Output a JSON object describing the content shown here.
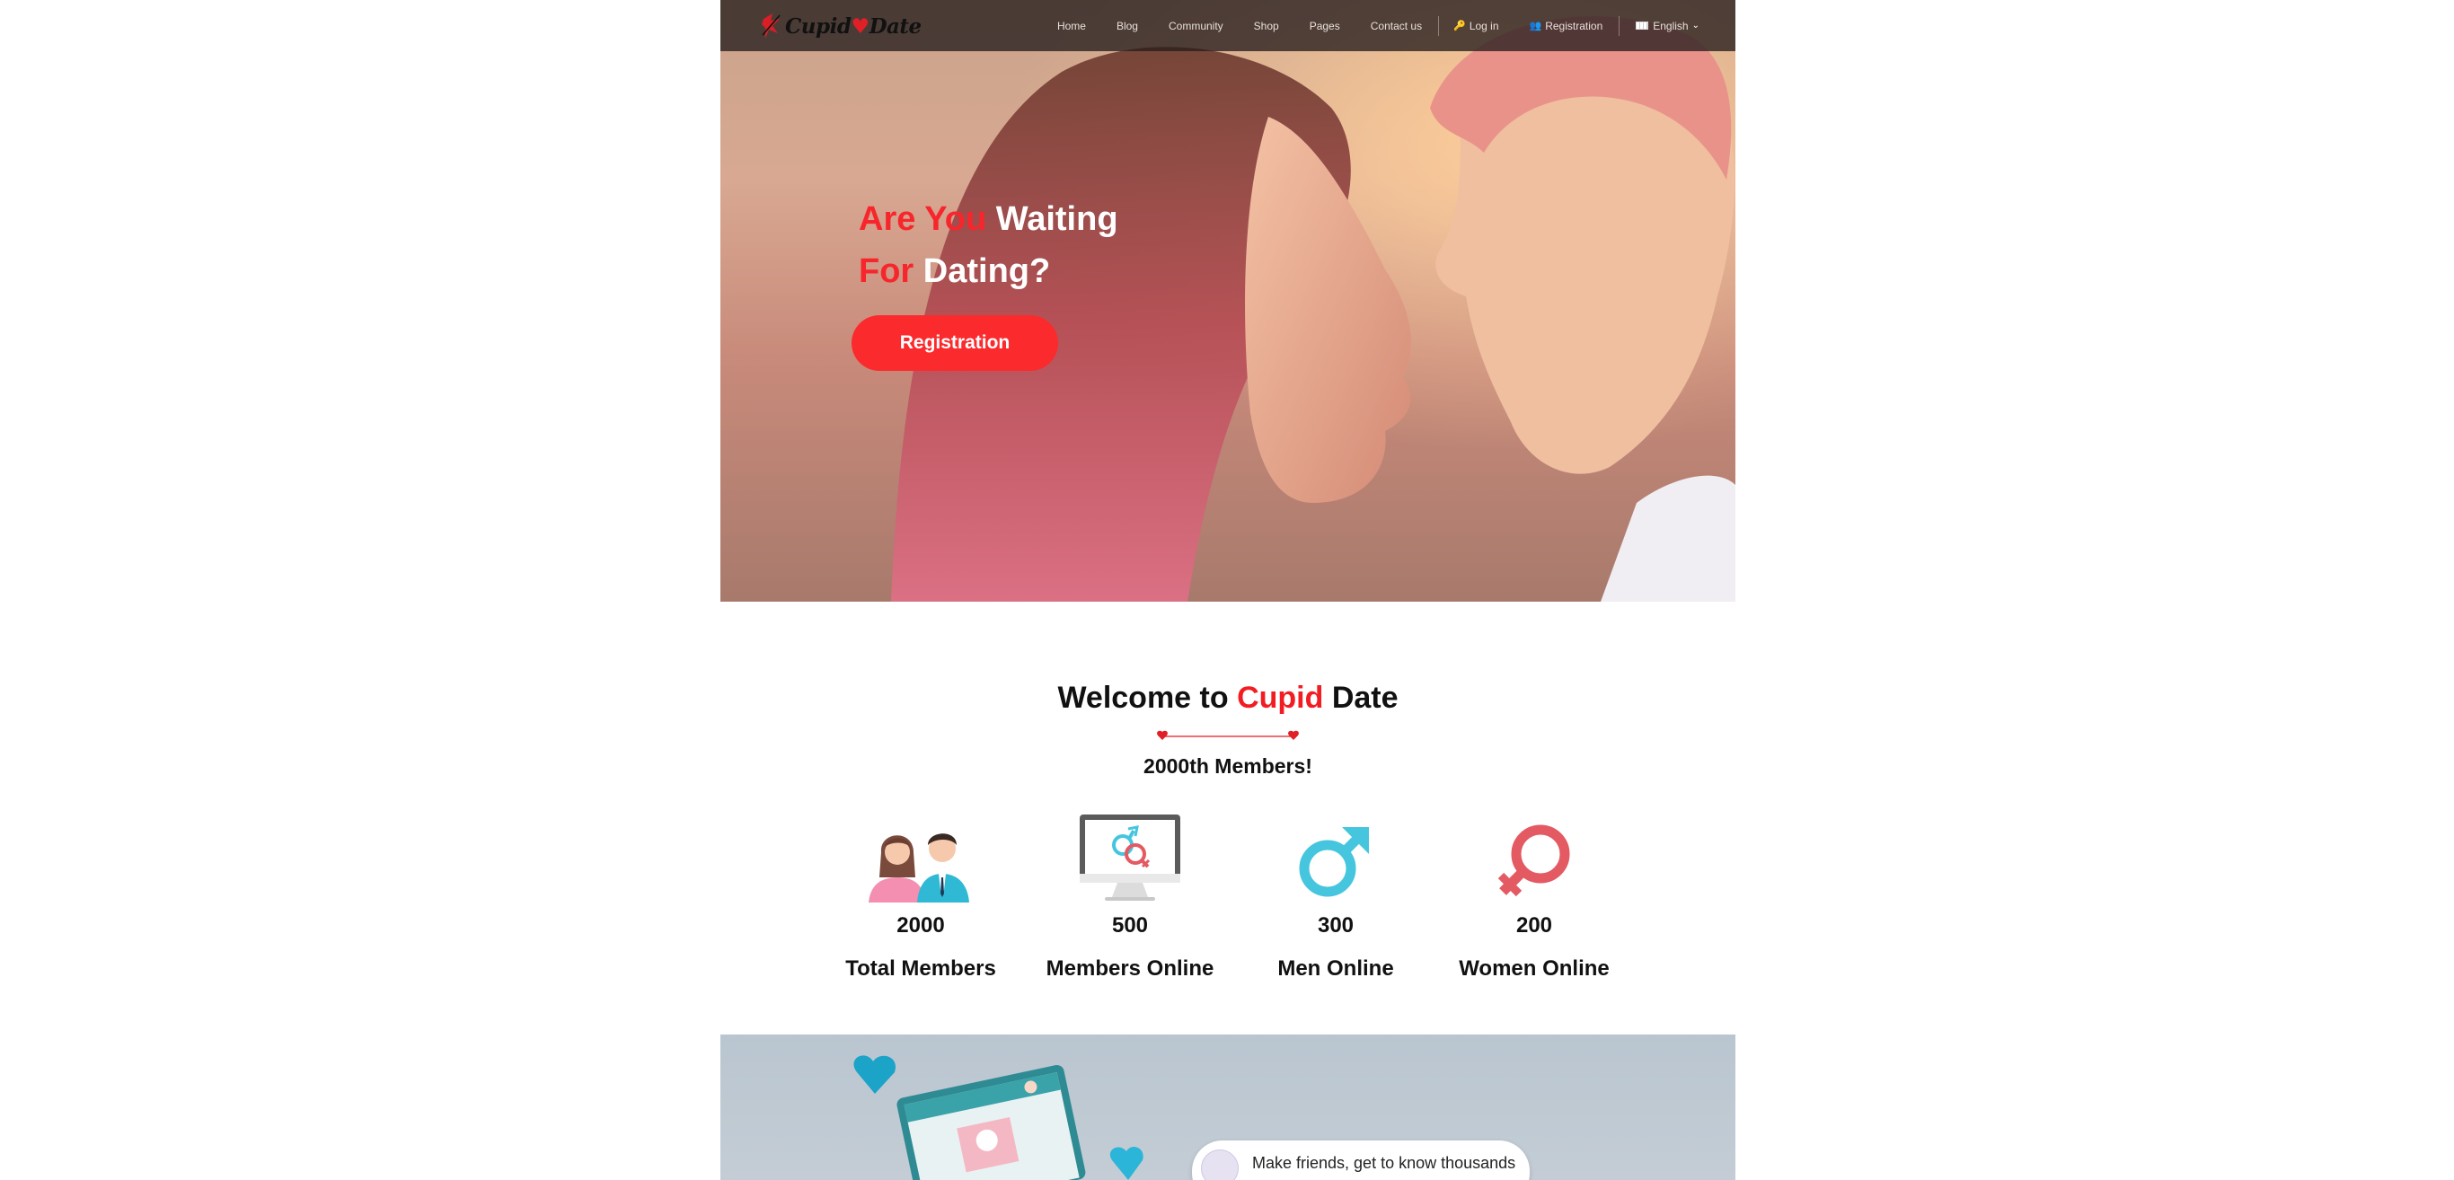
{
  "brand": {
    "name_part1": "Cupid",
    "name_part2": "Date"
  },
  "nav": {
    "links": [
      "Home",
      "Blog",
      "Community",
      "Shop",
      "Pages",
      "Contact us"
    ],
    "login": "Log in",
    "registration": "Registration",
    "language": "English"
  },
  "hero": {
    "line1_red": "Are You",
    "line1_white": "Waiting",
    "line2_red": "For",
    "line2_white": "Dating?",
    "button": "Registration"
  },
  "welcome": {
    "title_pre": "Welcome to",
    "title_red": "Cupid",
    "title_post": "Date",
    "subtitle": "2000th Members!"
  },
  "stats": [
    {
      "icon": "couple-icon",
      "value": "2000",
      "label": "Total Members"
    },
    {
      "icon": "monitor-gender-icon",
      "value": "500",
      "label": "Members Online"
    },
    {
      "icon": "male-symbol-icon",
      "value": "300",
      "label": "Men Online"
    },
    {
      "icon": "female-symbol-icon",
      "value": "200",
      "label": "Women Online"
    }
  ],
  "app_section": {
    "chat_text": "Make friends, get to know thousands"
  },
  "colors": {
    "accent": "#fb2a2d",
    "male": "#45c6de",
    "female": "#e35a63"
  }
}
